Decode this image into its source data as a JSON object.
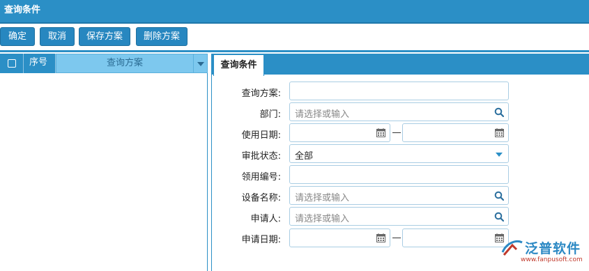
{
  "window": {
    "title": "查询条件"
  },
  "toolbar": {
    "confirm": "确定",
    "cancel": "取消",
    "save_plan": "保存方案",
    "delete_plan": "删除方案"
  },
  "grid": {
    "columns": [
      "序号",
      "查询方案"
    ]
  },
  "tab": {
    "label": "查询条件"
  },
  "form": {
    "query_plan": {
      "label": "查询方案:",
      "value": ""
    },
    "department": {
      "label": "部门:",
      "placeholder": "请选择或输入"
    },
    "use_date": {
      "label": "使用日期:",
      "separator": "—"
    },
    "approval_status": {
      "label": "审批状态:",
      "value": "全部"
    },
    "requisition_no": {
      "label": "领用编号:",
      "value": ""
    },
    "device_name": {
      "label": "设备名称:",
      "placeholder": "请选择或输入"
    },
    "applicant": {
      "label": "申请人:",
      "placeholder": "请选择或输入"
    },
    "apply_date": {
      "label": "申请日期:",
      "separator": "—"
    }
  },
  "logo": {
    "text": "泛普软件",
    "url": "www.fanpusoft.com"
  },
  "colors": {
    "primary": "#2b8fc6",
    "header_selected": "#7dc8ee"
  }
}
